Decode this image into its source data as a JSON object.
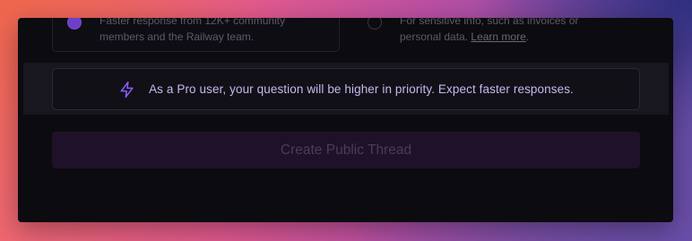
{
  "thread_options": [
    {
      "id": "public",
      "selected": true,
      "description_line1": "Faster response from 12K+ community",
      "description_line2": "members and the Railway team."
    },
    {
      "id": "private",
      "selected": false,
      "description_line1": "For sensitive info, such as invoices or",
      "description_line2_prefix": "personal data. ",
      "learn_more_link": "Learn more",
      "description_line2_suffix": "."
    }
  ],
  "priority_notice": {
    "icon": "bolt-icon",
    "text": "As a Pro user, your question will be higher in priority. Expect faster responses."
  },
  "actions": {
    "create_button_label": "Create Public Thread"
  },
  "colors": {
    "accent": "#8b5cf6",
    "notice_text": "#c9b6ee",
    "button_bg": "#1f1129",
    "panel_bg": "#0c0b10"
  }
}
